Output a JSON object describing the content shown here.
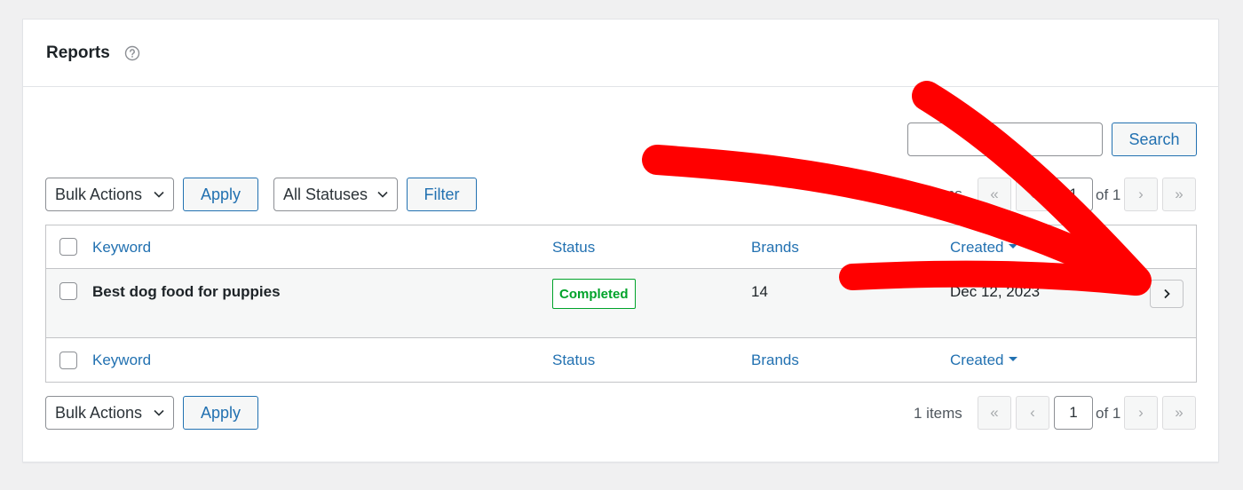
{
  "header": {
    "title": "Reports",
    "help_icon": "help-circle-icon"
  },
  "search": {
    "placeholder": "",
    "button_label": "Search"
  },
  "top_controls": {
    "bulk_actions_label": "Bulk Actions",
    "apply_label": "Apply",
    "status_filter_label": "All Statuses",
    "filter_label": "Filter",
    "items_text": "1 items",
    "first_page": "«",
    "prev_page": "‹",
    "current_page": "1",
    "of_text": "of 1",
    "next_page": "›",
    "last_page": "»"
  },
  "table": {
    "columns": {
      "keyword": "Keyword",
      "status": "Status",
      "brands": "Brands",
      "created": "Created"
    },
    "rows": [
      {
        "keyword": "Best dog food for puppies",
        "status": "Completed",
        "brands": "14",
        "created": "Dec 12, 2023"
      }
    ]
  },
  "bottom_controls": {
    "bulk_actions_label": "Bulk Actions",
    "apply_label": "Apply",
    "items_text": "1 items",
    "first_page": "«",
    "prev_page": "‹",
    "current_page": "1",
    "of_text": "of 1",
    "next_page": "›",
    "last_page": "»"
  },
  "colors": {
    "accent": "#2271b1",
    "status_completed": "#00a32a",
    "annotation_arrow": "#ff0000"
  }
}
